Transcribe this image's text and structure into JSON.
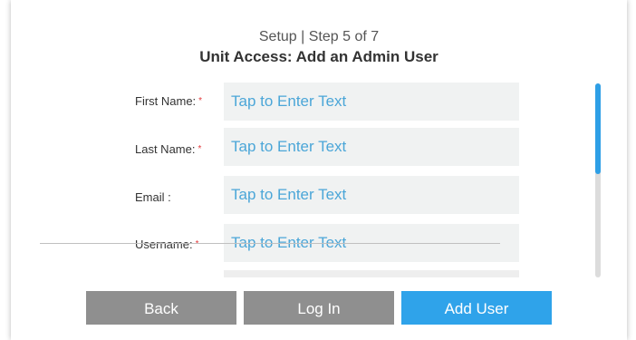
{
  "header": {
    "step": "Setup | Step 5 of 7",
    "title": "Unit Access: Add an Admin User"
  },
  "form": {
    "fields": [
      {
        "label": "First Name:",
        "required": true,
        "placeholder": "Tap to Enter Text"
      },
      {
        "label": "Last Name:",
        "required": true,
        "placeholder": "Tap to Enter Text"
      },
      {
        "label": "Email :",
        "required": false,
        "placeholder": "Tap to Enter Text"
      },
      {
        "label": "Username:",
        "required": true,
        "placeholder": "Tap to Enter Text"
      }
    ],
    "required_marker": "*"
  },
  "buttons": {
    "back": "Back",
    "login": "Log In",
    "add_user": "Add User"
  },
  "colors": {
    "accent": "#2fa3ea",
    "placeholder": "#4ba6d8",
    "required": "#e2383a",
    "button_gray": "#8f8f8f"
  }
}
